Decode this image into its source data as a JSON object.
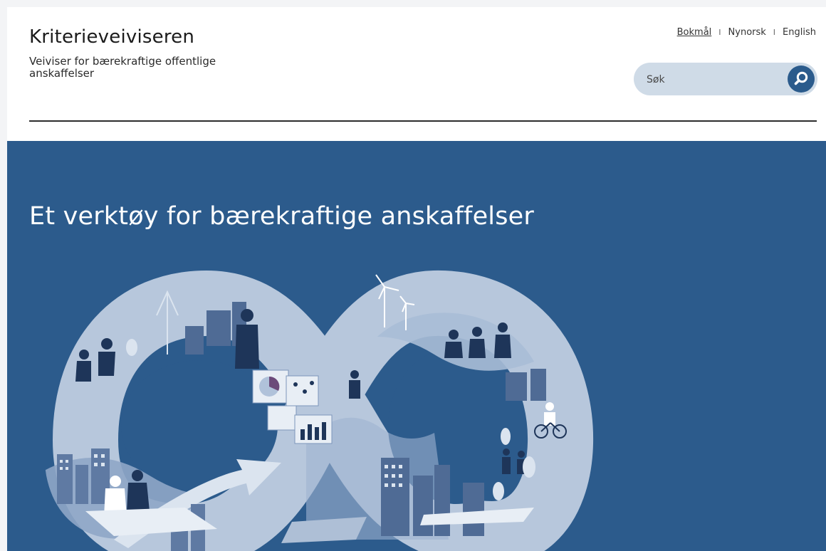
{
  "brand": {
    "title": "Kriterieveiviseren",
    "subtitle": "Veiviser for bærekraftige offentlige anskaffelser"
  },
  "languages": {
    "items": [
      {
        "label": "Bokmål",
        "active": true
      },
      {
        "label": "Nynorsk",
        "active": false
      },
      {
        "label": "English",
        "active": false
      }
    ],
    "separator": "I"
  },
  "search": {
    "placeholder": "Søk",
    "value": "",
    "icon": "search-icon"
  },
  "hero": {
    "title": "Et verktøy for bærekraftige anskaffelser",
    "illustration": "infinity-illustration"
  },
  "colors": {
    "hero_background": "#2c5b8c",
    "search_background": "#cfdbe7",
    "search_button": "#2b5b8c",
    "illustration_light": "#bfcde0",
    "illustration_mid": "#7d96ba",
    "illustration_dark": "#1e3559"
  }
}
